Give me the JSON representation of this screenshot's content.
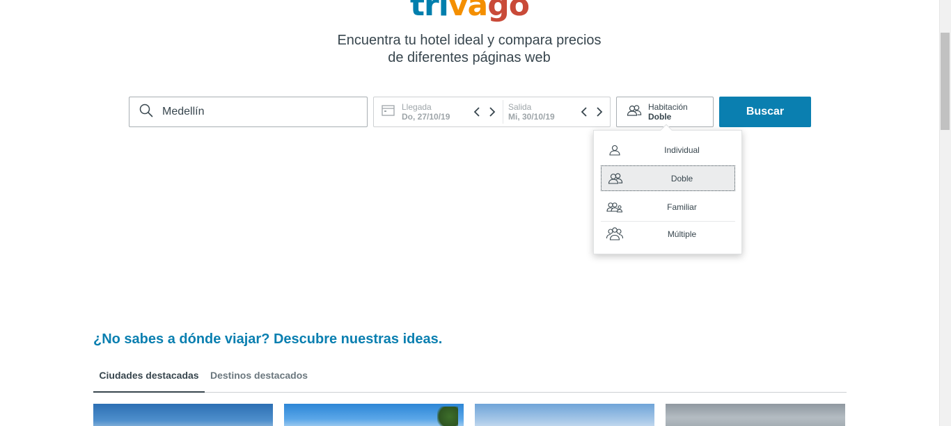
{
  "brand": {
    "logo_part1": "tri",
    "logo_part2": "va",
    "logo_part3": "go"
  },
  "hero": {
    "tagline_line1": "Encuentra tu hotel ideal y compara precios",
    "tagline_line2": "de diferentes páginas web"
  },
  "search": {
    "destination_value": "Medellín",
    "checkin_label": "Llegada",
    "checkin_value": "Do, 27/10/19",
    "checkout_label": "Salida",
    "checkout_value": "Mi, 30/10/19",
    "room_label": "Habitación",
    "room_value": "Doble",
    "submit_label": "Buscar"
  },
  "room_menu": {
    "options": [
      {
        "label": "Individual",
        "icon": "single-person-icon"
      },
      {
        "label": "Doble",
        "icon": "two-people-icon",
        "selected": true
      },
      {
        "label": "Familiar",
        "icon": "family-icon"
      },
      {
        "label": "Múltiple",
        "icon": "group-icon"
      }
    ]
  },
  "discover": {
    "heading": "¿No sabes a dónde viajar? Descubre nuestras ideas.",
    "tabs": [
      {
        "label": "Ciudades destacadas",
        "active": true
      },
      {
        "label": "Destinos destacados",
        "active": false
      }
    ]
  },
  "colors": {
    "accent": "#0a7fb0",
    "text": "#37454d",
    "logo_blue": "#007fad",
    "logo_orange": "#f48f00",
    "logo_red": "#c94a38"
  }
}
